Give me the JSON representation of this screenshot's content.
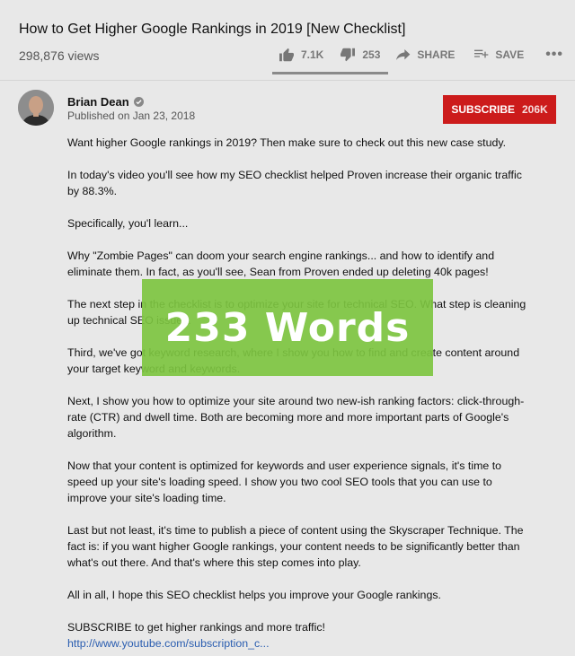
{
  "video": {
    "title": "How to Get Higher Google Rankings in 2019 [New Checklist]",
    "views": "298,876 views"
  },
  "actions": {
    "like_count": "7.1K",
    "dislike_count": "253",
    "share_label": "SHARE",
    "save_label": "SAVE",
    "more_label": "•••"
  },
  "channel": {
    "name": "Brian Dean",
    "published": "Published on Jan 23, 2018",
    "subscribe_label": "SUBSCRIBE",
    "subscriber_count": "206K"
  },
  "description": {
    "paragraphs": [
      "Want higher Google rankings in 2019? Then make sure to check out this new case study.",
      "In today's video you'll see how my SEO checklist helped Proven increase their organic traffic by 88.3%.",
      "Specifically, you'l learn...",
      "Why \"Zombie Pages\" can doom your search engine rankings... and how to identify and eliminate them. In fact, as you'll see, Sean from Proven ended up deleting 40k pages!",
      "The next step in the checklist is to optimize your site for technical SEO. What step is cleaning up technical SEO issues.",
      "Third, we've got keyword research, where I show you how to find and create content around your target keyword and keywords.",
      "Next, I show you how to optimize your site around two new-ish ranking factors: click-through-rate (CTR) and dwell time. Both are becoming more and more important parts of Google's algorithm.",
      "Now that your content is optimized for keywords and user experience signals, it's time to speed up your site's loading speed. I show you two cool SEO tools that you can use to improve your site's loading time.",
      "Last but not least, it's time to publish a piece of content using the Skyscraper Technique. The fact is: if you want higher Google rankings, your content needs to be significantly better than what's out there. And that's where this step comes into play.",
      "All in all, I hope this SEO checklist helps you improve your Google rankings."
    ],
    "cta": "SUBSCRIBE to get higher rankings and more traffic!",
    "link": "http://www.youtube.com/subscription_c..."
  },
  "overlay": {
    "text": "233 Words",
    "color": "#7dc440"
  },
  "colors": {
    "subscribe_red": "#cc1b1b",
    "link_blue": "#2a5db0"
  }
}
